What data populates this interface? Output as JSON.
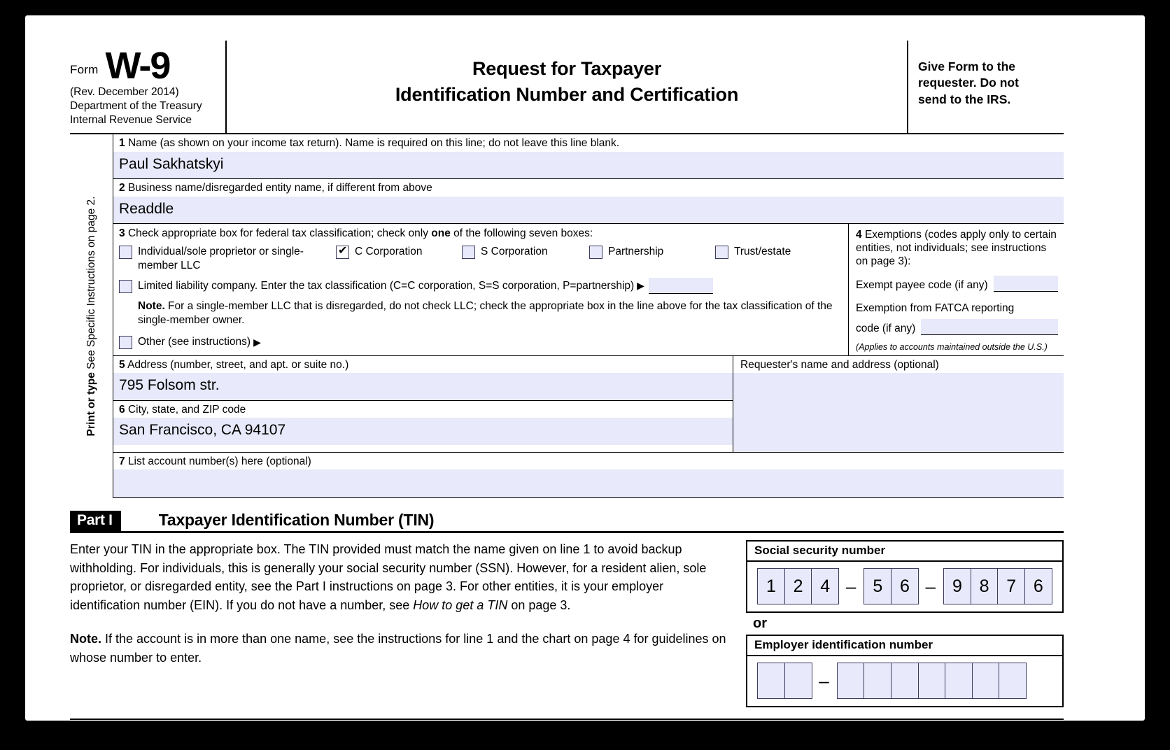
{
  "header": {
    "form_label": "Form",
    "form_number": "W-9",
    "revision": "(Rev. December 2014)",
    "department_line1": "Department of the Treasury",
    "department_line2": "Internal Revenue Service",
    "title_line1": "Request for Taxpayer",
    "title_line2": "Identification Number and Certification",
    "give_line1": "Give Form to the",
    "give_line2": "requester. Do not",
    "give_line3": "send to the IRS."
  },
  "sidebar": {
    "vertical_text_bold": "Print or type",
    "vertical_text_rest": "See Specific Instructions on page 2."
  },
  "line1": {
    "number": "1",
    "caption": "Name (as shown on your income tax return). Name is required on this line; do not leave this line blank.",
    "value": "Paul Sakhatskyi"
  },
  "line2": {
    "number": "2",
    "caption": "Business name/disregarded entity name, if different from above",
    "value": "Readdle"
  },
  "line3": {
    "number": "3",
    "caption_pre": "Check appropriate box for federal tax classification; check only ",
    "caption_bold": "one",
    "caption_post": " of the following seven boxes:",
    "checkboxes": [
      {
        "label": "Individual/sole proprietor or single-member LLC",
        "checked": false
      },
      {
        "label": "C Corporation",
        "checked": true
      },
      {
        "label": "S Corporation",
        "checked": false
      },
      {
        "label": "Partnership",
        "checked": false
      },
      {
        "label": "Trust/estate",
        "checked": false
      }
    ],
    "llc": {
      "label": "Limited liability company. Enter the tax classification (C=C corporation, S=S corporation, P=partnership)",
      "arrow": "▶",
      "value": "",
      "checked": false
    },
    "note_bold": "Note.",
    "note_text": " For a single-member LLC that is disregarded, do not check LLC; check the appropriate box in the line above for the tax classification of the single-member owner.",
    "other": {
      "label": "Other (see instructions)",
      "arrow": "▶",
      "checked": false
    }
  },
  "line4": {
    "number": "4",
    "heading": "Exemptions (codes apply only to certain entities, not individuals; see instructions on page 3):",
    "exempt_payee_label": "Exempt payee code (if any)",
    "exempt_payee_value": "",
    "fatca_label_line1": "Exemption from FATCA reporting",
    "fatca_label_line2": "code (if any)",
    "fatca_value": "",
    "footnote": "(Applies to accounts maintained outside the U.S.)"
  },
  "line5": {
    "number": "5",
    "caption": "Address (number, street, and apt. or suite no.)",
    "value": "795 Folsom str."
  },
  "line6": {
    "number": "6",
    "caption": "City, state, and ZIP code",
    "value": "San Francisco, CA 94107"
  },
  "line7": {
    "number": "7",
    "caption": "List account number(s) here (optional)",
    "value": ""
  },
  "requester": {
    "caption": "Requester's name and address (optional)",
    "value": ""
  },
  "part1": {
    "badge": "Part I",
    "title": "Taxpayer Identification Number (TIN)",
    "paragraph": "Enter your TIN in the appropriate box. The TIN provided must match the name given on line 1 to avoid backup withholding. For individuals, this is generally your social security number (SSN). However, for a resident alien, sole proprietor, or disregarded entity, see the Part I instructions on page 3. For other entities, it is your employer identification number (EIN). If you do not have a number, see ",
    "paragraph_italic": "How to get a TIN",
    "paragraph_tail": " on page 3.",
    "note_bold": "Note.",
    "note_text": " If the account is in more than one name, see the instructions for line 1 and the chart on page 4 for guidelines on whose number to enter.",
    "ssn_label": "Social security number",
    "ssn_digits_group1": [
      "1",
      "2",
      "4"
    ],
    "ssn_digits_group2": [
      "5",
      "6"
    ],
    "ssn_digits_group3": [
      "9",
      "8",
      "7",
      "6"
    ],
    "separator": "–",
    "or_label": "or",
    "ein_label": "Employer identification number",
    "ein_digits_group1": [
      "",
      ""
    ],
    "ein_digits_group2": [
      "",
      "",
      "",
      "",
      "",
      "",
      ""
    ]
  },
  "colors": {
    "field_fill": "#e8e9fa",
    "field_border": "#3b3b5c",
    "page_background": "#ffffff",
    "screen_background": "#000000"
  }
}
